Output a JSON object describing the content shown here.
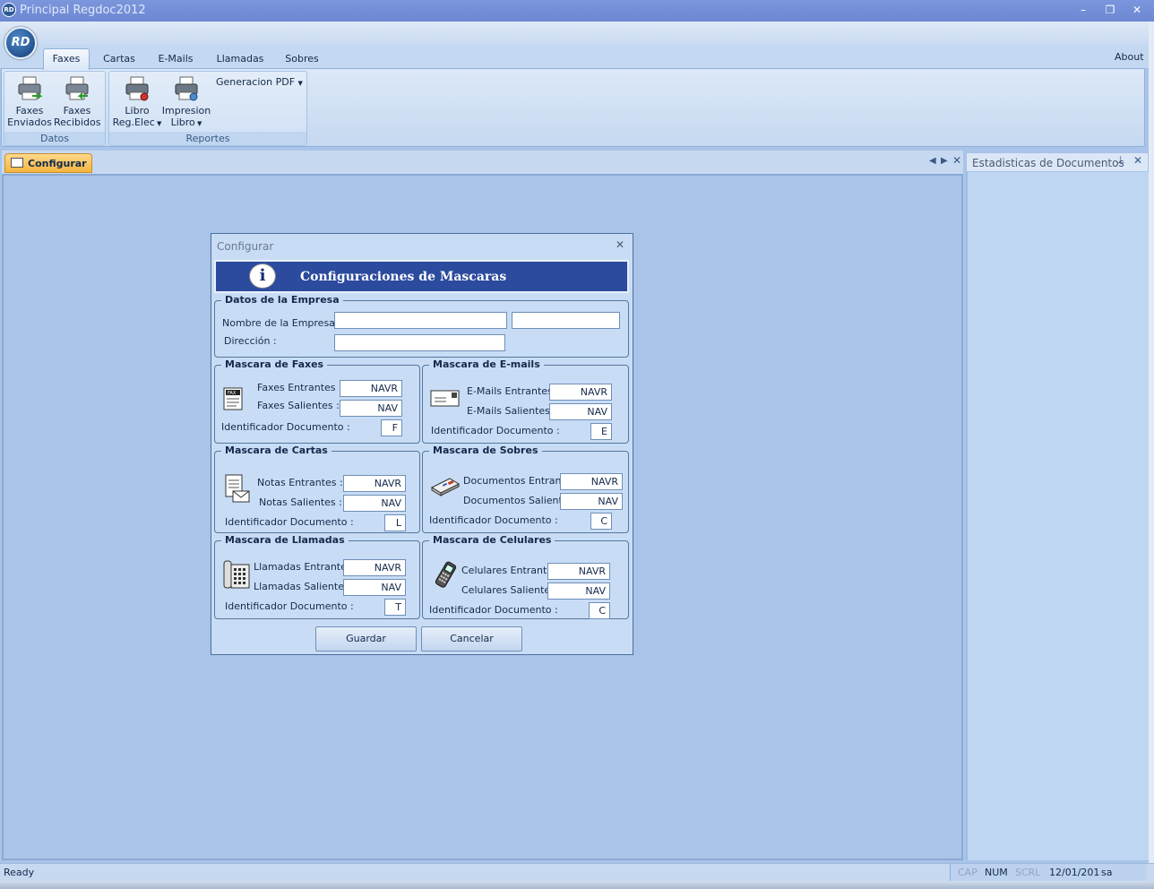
{
  "window": {
    "title": "Principal Regdoc2012",
    "logo_text": "RD"
  },
  "ribbon": {
    "tabs": [
      "Faxes",
      "Cartas",
      "E-Mails",
      "Llamadas",
      "Sobres"
    ],
    "about": "About",
    "groups": {
      "datos": {
        "label": "Datos",
        "buttons": [
          {
            "line1": "Faxes",
            "line2": "Enviados",
            "icon": "fax-printer-send-icon"
          },
          {
            "line1": "Faxes",
            "line2": "Recibidos",
            "icon": "fax-printer-receive-icon"
          }
        ]
      },
      "reportes": {
        "label": "Reportes",
        "buttons": [
          {
            "line1": "Libro",
            "line2": "Reg.Elec",
            "icon": "printer-record-icon"
          },
          {
            "line1": "Impresion",
            "line2": "Libro",
            "icon": "printer-book-icon"
          }
        ],
        "dropdown": "Generacion PDF"
      }
    }
  },
  "doc_tab": {
    "label": "Configurar"
  },
  "right_pane": {
    "title": "Estadisticas de Documentos"
  },
  "status": {
    "text": "Ready",
    "cap": "CAP",
    "num": "NUM",
    "scrl": "SCRL",
    "date": "12/01/201",
    "user": "sa"
  },
  "dialog": {
    "title": "Configurar",
    "banner": "Configuraciones de Mascaras",
    "empresa": {
      "legend": "Datos de la Empresa",
      "nombre_label": "Nombre de la Empresa :",
      "direccion_label": "Dirección :",
      "nombre_value": "",
      "nombre_value2": "",
      "direccion_value": ""
    },
    "faxes": {
      "legend": "Mascara de Faxes",
      "entrantes_label": "Faxes Entrantes :",
      "entrantes_value": "NAVR",
      "salientes_label": "Faxes Salientes :",
      "salientes_value": "NAV",
      "id_label": "Identificador Documento :",
      "id_value": "F"
    },
    "emails": {
      "legend": "Mascara de E-mails",
      "entrantes_label": "E-Mails  Entrantes :",
      "entrantes_value": "NAVR",
      "salientes_label": "E-Mails Salientes :",
      "salientes_value": "NAV",
      "id_label": "Identificador Documento :",
      "id_value": "E"
    },
    "cartas": {
      "legend": "Mascara de Cartas",
      "entrantes_label": "Notas Entrantes :",
      "entrantes_value": "NAVR",
      "salientes_label": "Notas Salientes :",
      "salientes_value": "NAV",
      "id_label": "Identificador Documento :",
      "id_value": "L"
    },
    "sobres": {
      "legend": "Mascara de Sobres",
      "entrantes_label": "Documentos Entrantes",
      "entrantes_value": "NAVR",
      "salientes_label": "Documentos Salientes",
      "salientes_value": "NAV",
      "id_label": "Identificador Documento :",
      "id_value": "C"
    },
    "llamadas": {
      "legend": "Mascara de Llamadas",
      "entrantes_label": "Llamadas Entrantes :",
      "entrantes_value": "NAVR",
      "salientes_label": "Llamadas Salientes :",
      "salientes_value": "NAV",
      "id_label": "Identificador Documento :",
      "id_value": "T"
    },
    "celulares": {
      "legend": "Mascara de Celulares",
      "entrantes_label": "Celulares Entrantes :",
      "entrantes_value": "NAVR",
      "salientes_label": "Celulares Salientes :",
      "salientes_value": "NAV",
      "id_label": "Identificador Documento :",
      "id_value": "C"
    },
    "guardar": "Guardar",
    "cancelar": "Cancelar"
  }
}
